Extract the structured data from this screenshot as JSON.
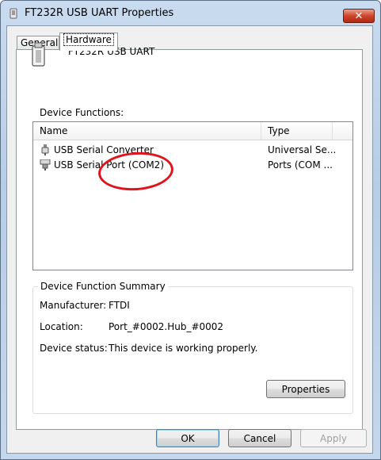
{
  "window": {
    "title": "FT232R USB UART Properties"
  },
  "tabs": [
    {
      "label": "General",
      "active": false
    },
    {
      "label": "Hardware",
      "active": true
    }
  ],
  "device": {
    "name": "FT232R USB UART"
  },
  "device_functions": {
    "label": "Device Functions:",
    "columns": [
      "Name",
      "Type"
    ],
    "rows": [
      {
        "name": "USB Serial Converter",
        "type": "Universal Se...",
        "icon": "usb-plug-icon"
      },
      {
        "name": "USB Serial Port (COM2)",
        "type": "Ports (COM ...",
        "icon": "serial-port-icon"
      }
    ]
  },
  "summary": {
    "title": "Device Function Summary",
    "manufacturer_label": "Manufacturer:",
    "manufacturer_value": "FTDI",
    "location_label": "Location:",
    "location_value": "Port_#0002.Hub_#0002",
    "status_label": "Device status:",
    "status_value": "This device is working properly.",
    "properties_button": "Properties"
  },
  "buttons": {
    "ok": "OK",
    "cancel": "Cancel",
    "apply": "Apply"
  },
  "colors": {
    "annotation": "#e0141e",
    "close_button": "#d0452b"
  }
}
